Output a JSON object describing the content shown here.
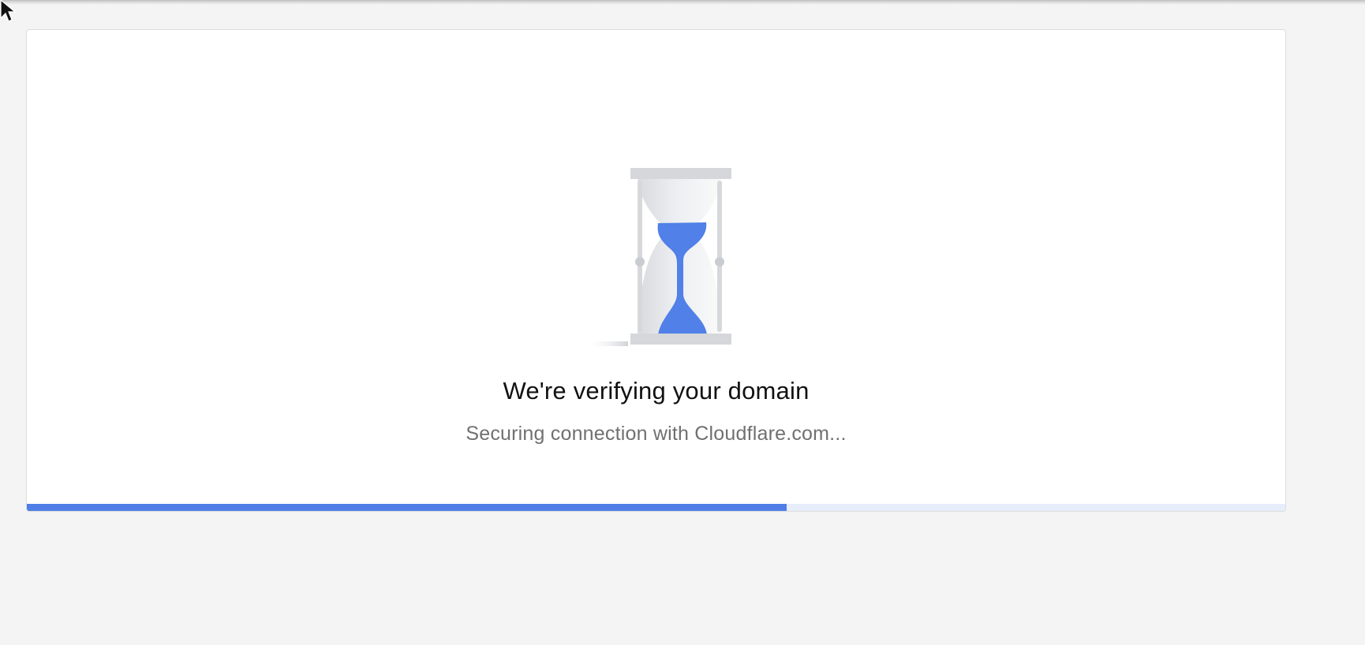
{
  "verification": {
    "title": "We're verifying your domain",
    "subtitle": "Securing connection with Cloudflare.com...",
    "illustration_icon": "hourglass-icon",
    "progress_fraction": 0.604
  },
  "colors": {
    "accent": "#4f7fe6",
    "progress_track": "#e7edfa",
    "background": "#f4f4f4",
    "card_background": "#ffffff",
    "title_text": "#111111",
    "subtitle_text": "#707070"
  },
  "cursor": {
    "icon": "mouse-pointer-icon"
  }
}
